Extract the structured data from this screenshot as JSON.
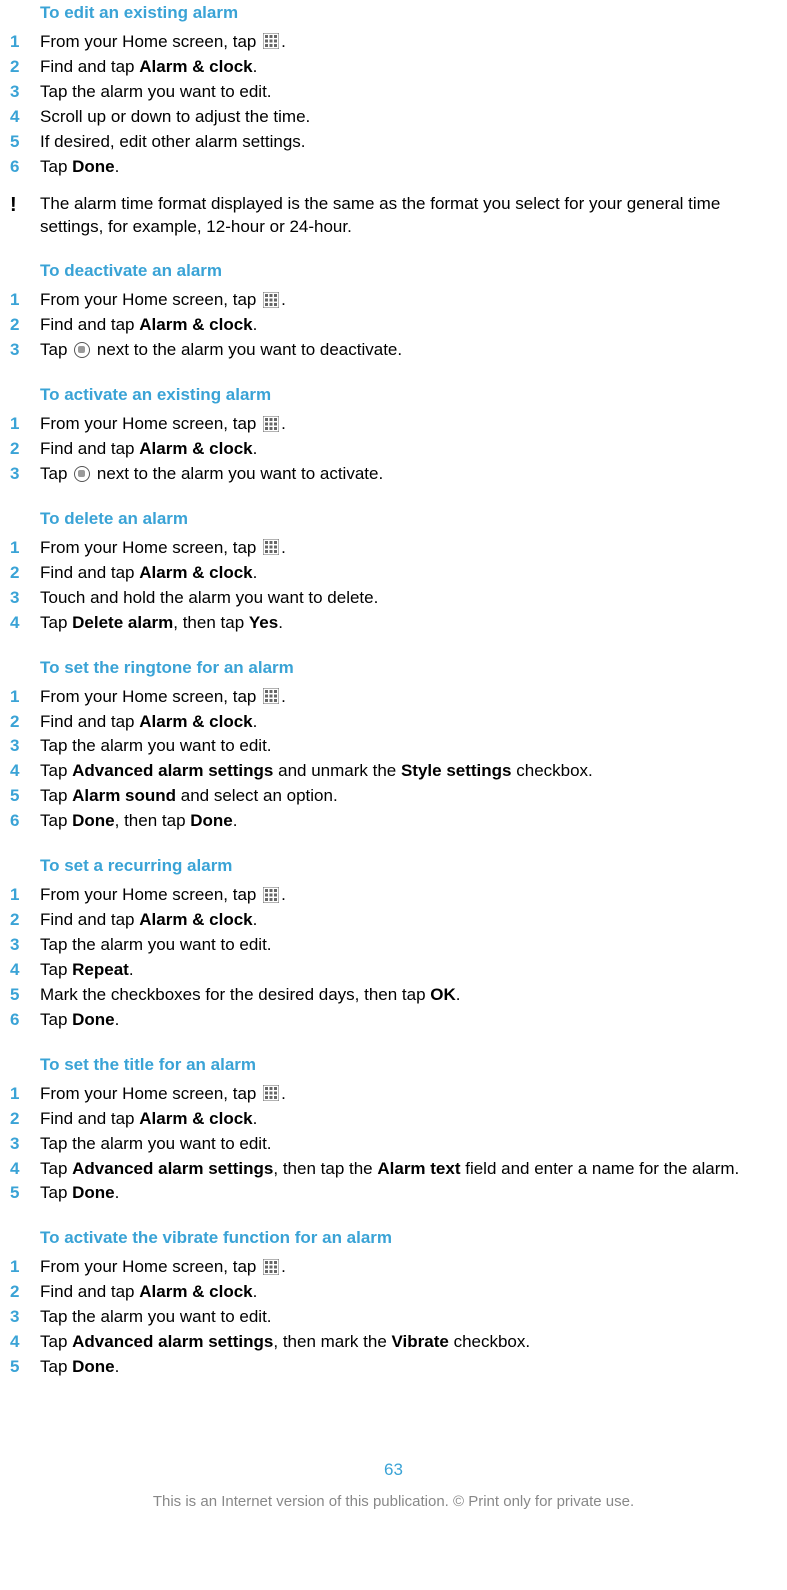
{
  "sections": [
    {
      "title": "To edit an existing alarm",
      "steps": [
        {
          "n": "1",
          "pre": "From your Home screen, tap ",
          "icon": "grid",
          "post": "."
        },
        {
          "n": "2",
          "pre": "Find and tap ",
          "b1": "Alarm & clock",
          "post": "."
        },
        {
          "n": "3",
          "pre": "Tap the alarm you want to edit."
        },
        {
          "n": "4",
          "pre": "Scroll up or down to adjust the time."
        },
        {
          "n": "5",
          "pre": "If desired, edit other alarm settings."
        },
        {
          "n": "6",
          "pre": "Tap ",
          "b1": "Done",
          "post": "."
        }
      ],
      "note": "The alarm time format displayed is the same as the format you select for your general time settings, for example, 12-hour or 24-hour."
    },
    {
      "title": "To deactivate an alarm",
      "steps": [
        {
          "n": "1",
          "pre": "From your Home screen, tap ",
          "icon": "grid",
          "post": "."
        },
        {
          "n": "2",
          "pre": "Find and tap ",
          "b1": "Alarm & clock",
          "post": "."
        },
        {
          "n": "3",
          "pre": "Tap ",
          "icon": "circle",
          "post": " next to the alarm you want to deactivate."
        }
      ]
    },
    {
      "title": "To activate an existing alarm",
      "steps": [
        {
          "n": "1",
          "pre": "From your Home screen, tap ",
          "icon": "grid",
          "post": "."
        },
        {
          "n": "2",
          "pre": "Find and tap ",
          "b1": "Alarm & clock",
          "post": "."
        },
        {
          "n": "3",
          "pre": "Tap ",
          "icon": "circle",
          "post": " next to the alarm you want to activate."
        }
      ]
    },
    {
      "title": "To delete an alarm",
      "steps": [
        {
          "n": "1",
          "pre": "From your Home screen, tap ",
          "icon": "grid",
          "post": "."
        },
        {
          "n": "2",
          "pre": "Find and tap ",
          "b1": "Alarm & clock",
          "post": "."
        },
        {
          "n": "3",
          "pre": "Touch and hold the alarm you want to delete."
        },
        {
          "n": "4",
          "pre": "Tap ",
          "b1": "Delete alarm",
          "mid": ", then tap ",
          "b2": "Yes",
          "post": "."
        }
      ]
    },
    {
      "title": "To set the ringtone for an alarm",
      "steps": [
        {
          "n": "1",
          "pre": "From your Home screen, tap ",
          "icon": "grid",
          "post": "."
        },
        {
          "n": "2",
          "pre": "Find and tap ",
          "b1": "Alarm & clock",
          "post": "."
        },
        {
          "n": "3",
          "pre": "Tap the alarm you want to edit."
        },
        {
          "n": "4",
          "pre": "Tap ",
          "b1": "Advanced alarm settings",
          "mid": " and unmark the ",
          "b2": "Style settings",
          "post": " checkbox."
        },
        {
          "n": "5",
          "pre": "Tap ",
          "b1": "Alarm sound",
          "post": " and select an option."
        },
        {
          "n": "6",
          "pre": "Tap ",
          "b1": "Done",
          "mid": ", then tap ",
          "b2": "Done",
          "post": "."
        }
      ]
    },
    {
      "title": "To set a recurring alarm",
      "steps": [
        {
          "n": "1",
          "pre": "From your Home screen, tap ",
          "icon": "grid",
          "post": "."
        },
        {
          "n": "2",
          "pre": "Find and tap ",
          "b1": "Alarm & clock",
          "post": "."
        },
        {
          "n": "3",
          "pre": "Tap the alarm you want to edit."
        },
        {
          "n": "4",
          "pre": "Tap ",
          "b1": "Repeat",
          "post": "."
        },
        {
          "n": "5",
          "pre": "Mark the checkboxes for the desired days, then tap ",
          "b1": "OK",
          "post": "."
        },
        {
          "n": "6",
          "pre": "Tap ",
          "b1": "Done",
          "post": "."
        }
      ]
    },
    {
      "title": "To set the title for an alarm",
      "steps": [
        {
          "n": "1",
          "pre": "From your Home screen, tap ",
          "icon": "grid",
          "post": "."
        },
        {
          "n": "2",
          "pre": "Find and tap ",
          "b1": "Alarm & clock",
          "post": "."
        },
        {
          "n": "3",
          "pre": "Tap the alarm you want to edit."
        },
        {
          "n": "4",
          "pre": "Tap ",
          "b1": "Advanced alarm settings",
          "mid": ", then tap the ",
          "b2": "Alarm text",
          "post": " field and enter a name for the alarm."
        },
        {
          "n": "5",
          "pre": "Tap ",
          "b1": "Done",
          "post": "."
        }
      ]
    },
    {
      "title": "To activate the vibrate function for an alarm",
      "steps": [
        {
          "n": "1",
          "pre": "From your Home screen, tap ",
          "icon": "grid",
          "post": "."
        },
        {
          "n": "2",
          "pre": "Find and tap ",
          "b1": "Alarm & clock",
          "post": "."
        },
        {
          "n": "3",
          "pre": "Tap the alarm you want to edit."
        },
        {
          "n": "4",
          "pre": "Tap ",
          "b1": "Advanced alarm settings",
          "mid": ", then mark the ",
          "b2": "Vibrate",
          "post": " checkbox."
        },
        {
          "n": "5",
          "pre": "Tap ",
          "b1": "Done",
          "post": "."
        }
      ]
    }
  ],
  "pageNumber": "63",
  "footerNote": "This is an Internet version of this publication. © Print only for private use."
}
